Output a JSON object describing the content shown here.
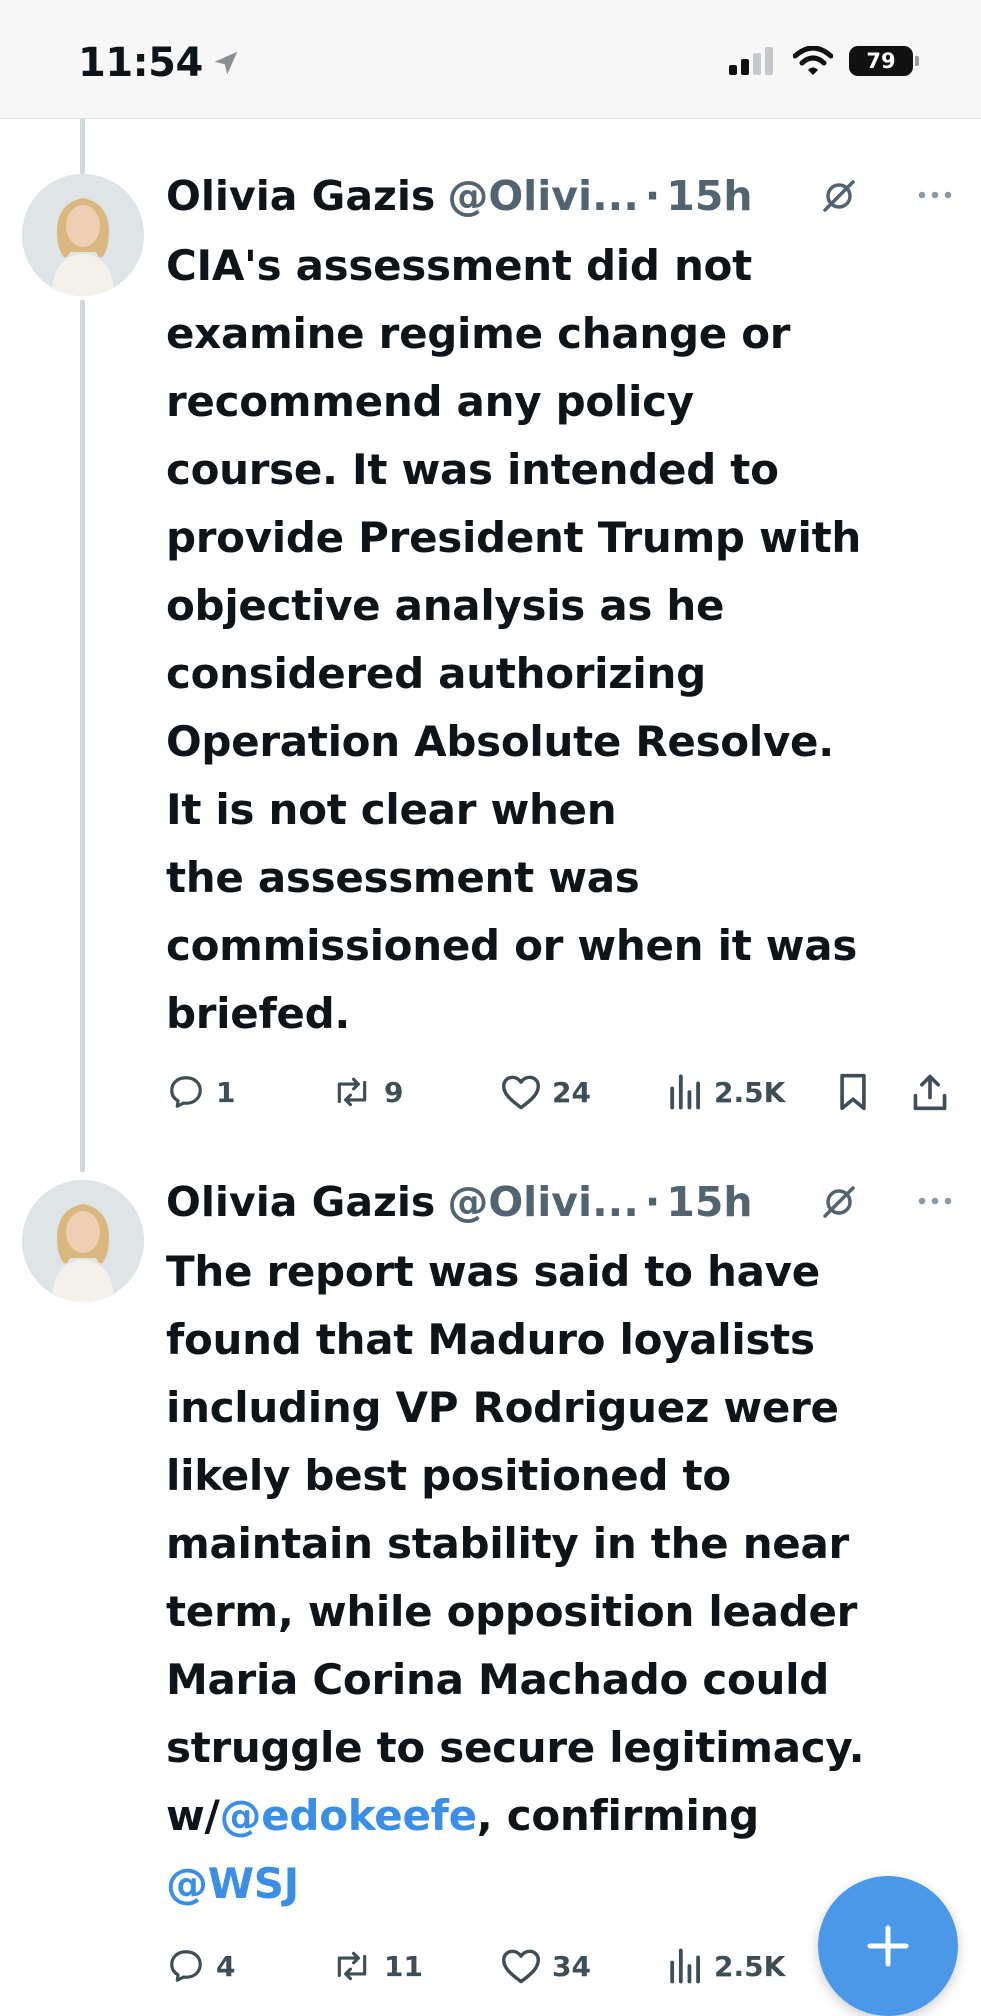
{
  "status_bar": {
    "time": "11:54",
    "battery": "79"
  },
  "tweets": [
    {
      "name": "Olivia Gazis",
      "handle": "@Olivi...",
      "separator": "·",
      "time_ago": "15h",
      "text": "CIA's assessment did not\nexamine regime change or\nrecommend any policy\ncourse. It was intended to\nprovide President Trump with\nobjective analysis as he\nconsidered authorizing\nOperation Absolute Resolve.\nIt is not clear when\nthe assessment was\ncommissioned or when it was\nbriefed.",
      "replies": "1",
      "reposts": "9",
      "likes": "24",
      "views": "2.5K"
    },
    {
      "name": "Olivia Gazis",
      "handle": "@Olivi...",
      "separator": "·",
      "time_ago": "15h",
      "text_part1": "The report was said to have\nfound that Maduro loyalists\nincluding VP Rodriguez were\nlikely best positioned to\nmaintain stability in the near\nterm, while opposition leader\nMaria Corina Machado could\nstruggle to secure legitimacy.\nw/",
      "mention1": "@edokeefe",
      "text_part2": ", confirming\n",
      "mention2": "@WSJ",
      "replies": "4",
      "reposts": "11",
      "likes": "34",
      "views": "2.5K"
    }
  ],
  "icons": {
    "location": "location-arrow-icon",
    "signal": "cellular-signal-icon",
    "wifi": "wifi-icon",
    "grok": "grok-icon",
    "more": "more-dots-icon",
    "reply": "reply-icon",
    "repost": "repost-icon",
    "like": "heart-icon",
    "views": "views-icon",
    "bookmark": "bookmark-icon",
    "share": "share-icon",
    "compose": "plus-icon"
  },
  "colors": {
    "accent": "#4b98e8",
    "mention": "#3a8ee6",
    "muted": "#536471"
  }
}
